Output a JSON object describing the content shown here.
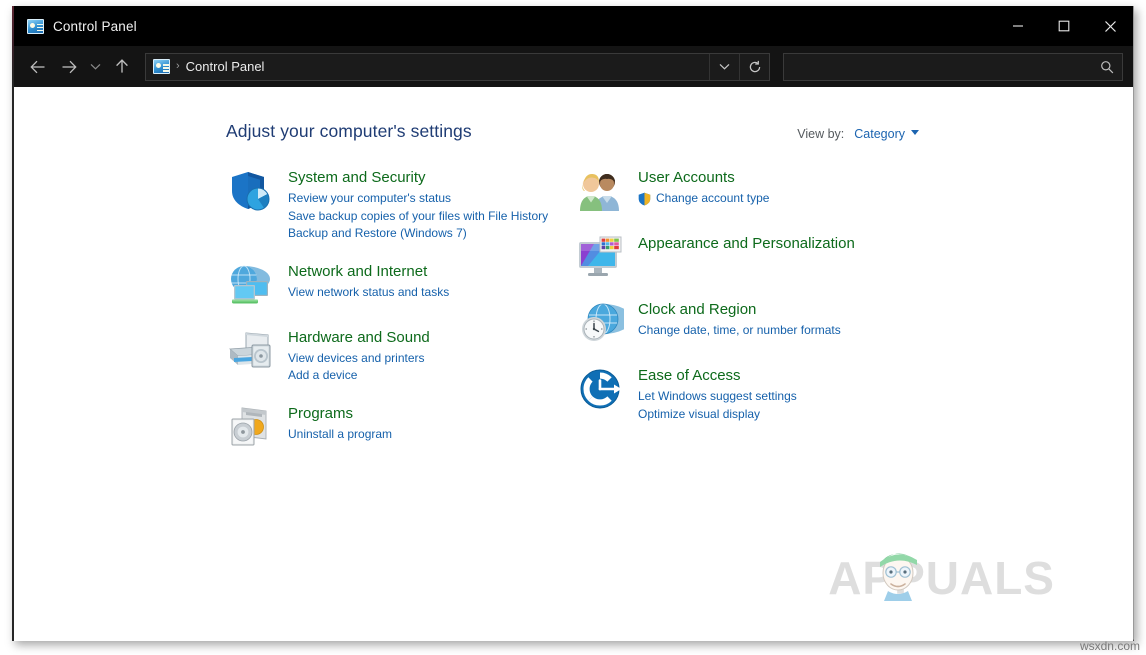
{
  "window": {
    "title": "Control Panel",
    "title_icon": "control-panel-icon",
    "controls": {
      "minimize": "minimize-icon",
      "maximize": "maximize-icon",
      "close": "close-icon"
    }
  },
  "navbar": {
    "back": "back-arrow-icon",
    "forward": "forward-arrow-icon",
    "recent": "chevron-down-icon",
    "up": "up-arrow-icon",
    "breadcrumb_icon": "control-panel-icon",
    "breadcrumb_separator": "›",
    "breadcrumb_label": "Control Panel",
    "address_dropdown": "chevron-down-icon",
    "refresh": "refresh-icon",
    "search_placeholder": "",
    "search_value": "",
    "search_icon": "search-icon"
  },
  "main": {
    "page_title": "Adjust your computer's settings",
    "view_by_label": "View by:",
    "view_by_value": "Category",
    "view_by_caret": "caret-down-icon",
    "left_column": [
      {
        "icon": "shield-pie-icon",
        "title": "System and Security",
        "links": [
          {
            "label": "Review your computer's status",
            "shield": false
          },
          {
            "label": "Save backup copies of your files with File History",
            "shield": false
          },
          {
            "label": "Backup and Restore (Windows 7)",
            "shield": false
          }
        ]
      },
      {
        "icon": "network-globe-monitors-icon",
        "title": "Network and Internet",
        "links": [
          {
            "label": "View network status and tasks",
            "shield": false
          }
        ]
      },
      {
        "icon": "printer-speaker-icon",
        "title": "Hardware and Sound",
        "links": [
          {
            "label": "View devices and printers",
            "shield": false
          },
          {
            "label": "Add a device",
            "shield": false
          }
        ]
      },
      {
        "icon": "program-box-disc-icon",
        "title": "Programs",
        "links": [
          {
            "label": "Uninstall a program",
            "shield": false
          }
        ]
      }
    ],
    "right_column": [
      {
        "icon": "users-icon",
        "title": "User Accounts",
        "links": [
          {
            "label": "Change account type",
            "shield": true
          }
        ]
      },
      {
        "icon": "monitor-palette-icon",
        "title": "Appearance and Personalization",
        "links": []
      },
      {
        "icon": "globe-clock-icon",
        "title": "Clock and Region",
        "links": [
          {
            "label": "Change date, time, or number formats",
            "shield": false
          }
        ]
      },
      {
        "icon": "ease-of-access-icon",
        "title": "Ease of Access",
        "links": [
          {
            "label": "Let Windows suggest settings",
            "shield": false
          },
          {
            "label": "Optimize visual display",
            "shield": false
          }
        ]
      }
    ]
  },
  "watermark": {
    "text": "APPUALS",
    "face": "appuals-mascot-icon"
  },
  "footer": {
    "source_text": "wsxdn.com"
  },
  "colors": {
    "titlebar_bg": "#000000",
    "navbar_bg": "#141414",
    "content_bg": "#ffffff",
    "page_title": "#1f3c74",
    "category_title": "#0d6a1b",
    "link": "#1661ab",
    "view_by_label": "#555a5e",
    "watermark": "#d9d9d9"
  }
}
